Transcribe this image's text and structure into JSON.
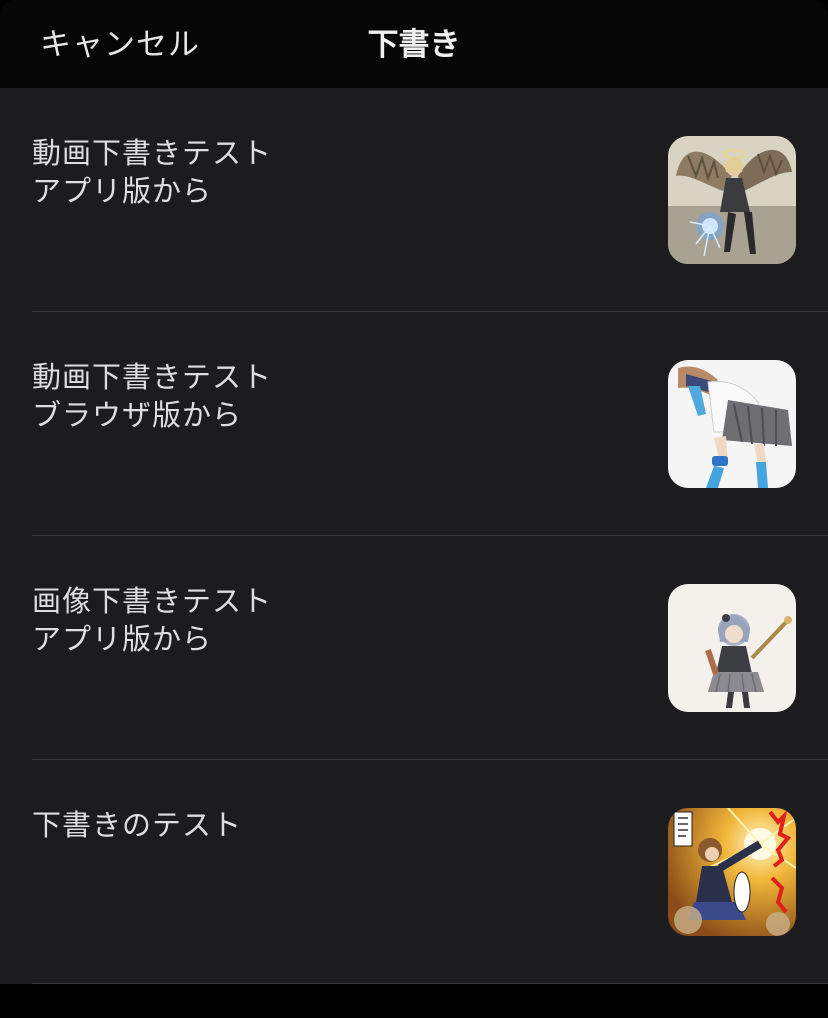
{
  "header": {
    "cancel_label": "キャンセル",
    "title": "下書き"
  },
  "drafts": [
    {
      "line1": "動画下書きテスト",
      "line2": "アプリ版から",
      "thumbnail": "winged-angel-illustration"
    },
    {
      "line1": "動画下書きテスト",
      "line2": "ブラウザ版から",
      "thumbnail": "schoolgirl-sailor-uniform-illustration"
    },
    {
      "line1": "画像下書きテスト",
      "line2": "アプリ版から",
      "thumbnail": "silver-haired-girl-with-sword-illustration"
    },
    {
      "line1": "下書きのテスト",
      "line2": "",
      "thumbnail": "manga-action-panel-illustration"
    }
  ],
  "colors": {
    "background": "#1c1c1e",
    "header": "#060606",
    "divider": "#3a3a3c",
    "text": "#dedee0"
  }
}
